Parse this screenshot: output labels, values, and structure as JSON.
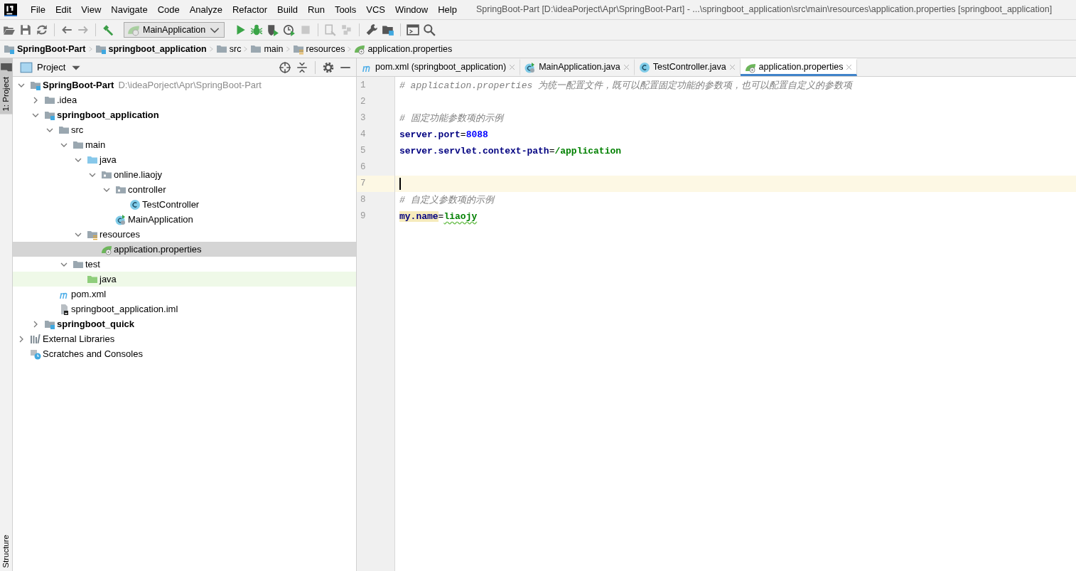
{
  "menu_bar": {
    "items": [
      "File",
      "Edit",
      "View",
      "Navigate",
      "Code",
      "Analyze",
      "Refactor",
      "Build",
      "Run",
      "Tools",
      "VCS",
      "Window",
      "Help"
    ],
    "title": "SpringBoot-Part [D:\\ideaPorject\\Apr\\SpringBoot-Part] - ...\\springboot_application\\src\\main\\resources\\application.properties [springboot_application]"
  },
  "toolbar": {
    "run_configuration": "MainApplication"
  },
  "breadcrumbs": [
    {
      "label": "SpringBoot-Part",
      "kind": "module"
    },
    {
      "label": "springboot_application",
      "kind": "module"
    },
    {
      "label": "src",
      "kind": "folder"
    },
    {
      "label": "main",
      "kind": "folder"
    },
    {
      "label": "resources",
      "kind": "resources"
    },
    {
      "label": "application.properties",
      "kind": "properties"
    }
  ],
  "side_tabs_top": [
    {
      "label": "1: Project",
      "selected": true
    }
  ],
  "side_tabs_bottom": [
    {
      "label": "Structure",
      "selected": false
    }
  ],
  "project_panel": {
    "title": "Project",
    "tree": [
      {
        "label": "SpringBoot-Part",
        "location": "D:\\ideaPorject\\Apr\\SpringBoot-Part",
        "kind": "module",
        "expanded": true,
        "selected": false,
        "children": [
          {
            "label": ".idea",
            "kind": "folder",
            "expanded": false,
            "selected": false
          },
          {
            "label": "springboot_application",
            "kind": "module",
            "expanded": true,
            "selected": false,
            "children": [
              {
                "label": "src",
                "kind": "folder",
                "expanded": true,
                "selected": false,
                "children": [
                  {
                    "label": "main",
                    "kind": "folder",
                    "expanded": true,
                    "selected": false,
                    "children": [
                      {
                        "label": "java",
                        "kind": "source",
                        "expanded": true,
                        "selected": false,
                        "children": [
                          {
                            "label": "online.liaojy",
                            "kind": "package",
                            "expanded": true,
                            "selected": false,
                            "children": [
                              {
                                "label": "controller",
                                "kind": "package",
                                "expanded": true,
                                "selected": false,
                                "children": [
                                  {
                                    "label": "TestController",
                                    "kind": "class",
                                    "selected": false
                                  }
                                ]
                              },
                              {
                                "label": "MainApplication",
                                "kind": "main-class",
                                "selected": false
                              }
                            ]
                          }
                        ]
                      },
                      {
                        "label": "resources",
                        "kind": "resources",
                        "expanded": true,
                        "selected": false,
                        "children": [
                          {
                            "label": "application.properties",
                            "kind": "properties",
                            "selected": true
                          }
                        ]
                      }
                    ]
                  },
                  {
                    "label": "test",
                    "kind": "folder",
                    "expanded": true,
                    "selected": false,
                    "children": [
                      {
                        "label": "java",
                        "kind": "test-source",
                        "selected": false
                      }
                    ]
                  }
                ]
              },
              {
                "label": "pom.xml",
                "kind": "maven",
                "selected": false
              },
              {
                "label": "springboot_application.iml",
                "kind": "iml",
                "selected": false
              }
            ]
          },
          {
            "label": "springboot_quick",
            "kind": "module",
            "expanded": false,
            "selected": false
          }
        ]
      },
      {
        "label": "External Libraries",
        "kind": "libraries",
        "expanded": false,
        "selected": false
      },
      {
        "label": "Scratches and Consoles",
        "kind": "scratches",
        "selected": false
      }
    ]
  },
  "editor": {
    "tabs": [
      {
        "label": "pom.xml (springboot_application)",
        "kind": "maven",
        "selected": false
      },
      {
        "label": "MainApplication.java",
        "kind": "main-class",
        "selected": false
      },
      {
        "label": "TestController.java",
        "kind": "class",
        "selected": false
      },
      {
        "label": "application.properties",
        "kind": "properties",
        "selected": true
      }
    ],
    "lines": [
      {
        "number": "1",
        "current": false,
        "tokens": [
          {
            "text": "# application.properties 为统一配置文件，既可以配置固定功能的参数项，也可以配置自定义的参数项",
            "kind": "comment"
          }
        ]
      },
      {
        "number": "2",
        "current": false
      },
      {
        "number": "3",
        "current": false,
        "tokens": [
          {
            "text": "# 固定功能参数项的示例",
            "kind": "comment"
          }
        ]
      },
      {
        "number": "4",
        "current": false,
        "tokens": [
          {
            "text": "server.port",
            "kind": "key"
          },
          {
            "text": "=",
            "kind": "separator"
          },
          {
            "text": "8088",
            "kind": "number"
          }
        ]
      },
      {
        "number": "5",
        "current": false,
        "tokens": [
          {
            "text": "server.servlet.context-path",
            "kind": "key"
          },
          {
            "text": "=",
            "kind": "separator"
          },
          {
            "text": "/application",
            "kind": "value"
          }
        ]
      },
      {
        "number": "6",
        "current": false
      },
      {
        "number": "7",
        "current": true
      },
      {
        "number": "8",
        "current": false,
        "tokens": [
          {
            "text": "# 自定义参数项的示例",
            "kind": "comment"
          }
        ]
      },
      {
        "number": "9",
        "current": false,
        "tokens": [
          {
            "text": "my.name",
            "kind": "key-marked"
          },
          {
            "text": "=",
            "kind": "separator"
          },
          {
            "text": "liaojy",
            "kind": "value-typo"
          }
        ]
      }
    ]
  }
}
